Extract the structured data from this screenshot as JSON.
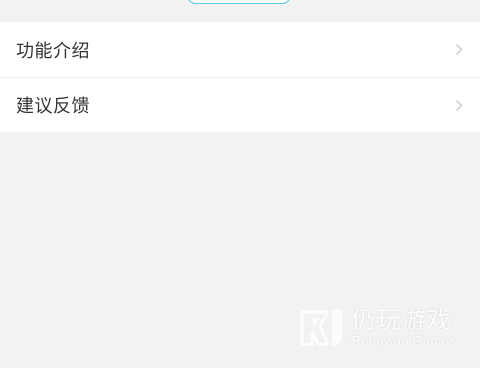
{
  "menu": {
    "items": [
      {
        "label": "功能介绍"
      },
      {
        "label": "建议反馈"
      }
    ]
  },
  "watermark": {
    "title": "仍玩游戏",
    "subtitle": "Rengwan Games"
  },
  "icons": {
    "menu_arrow": "chevron-right-icon",
    "logo": "rengwan-logo-icon"
  },
  "colors": {
    "page_background": "#f2f2f2",
    "card_background": "#ffffff",
    "label_text": "#333333",
    "chevron": "#c8c8c8",
    "pill_border": "#56c7e8"
  }
}
